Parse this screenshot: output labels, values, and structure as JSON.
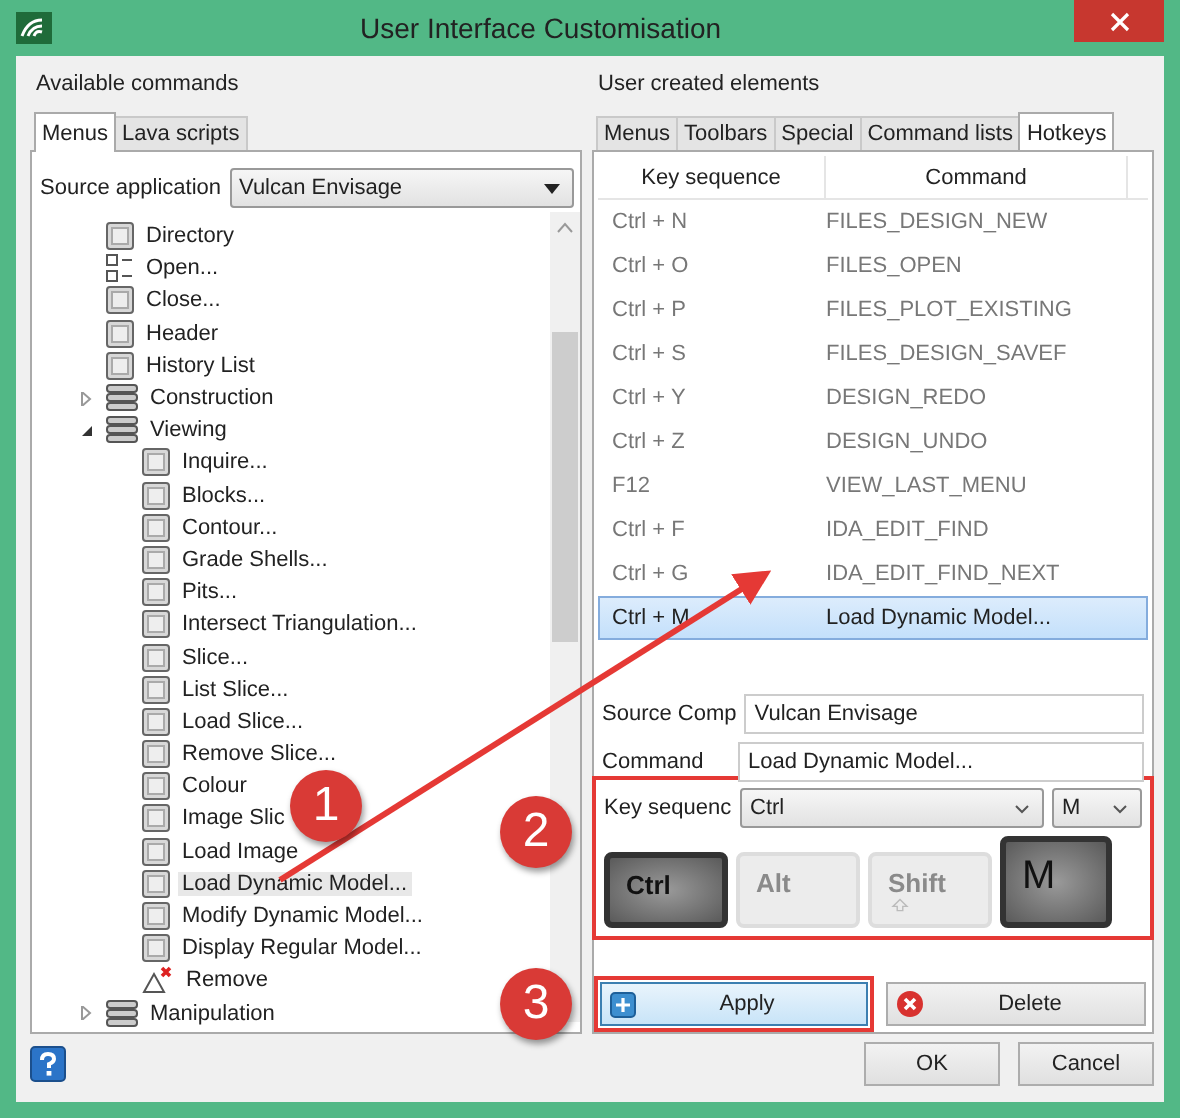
{
  "window": {
    "title": "User Interface Customisation"
  },
  "left": {
    "heading": "Available commands",
    "tabs": [
      {
        "label": "Menus",
        "selected": true
      },
      {
        "label": "Lava scripts",
        "selected": false
      }
    ],
    "source_label": "Source application",
    "source_value": "Vulcan Envisage",
    "tree": [
      {
        "label": "Directory",
        "kind": "command",
        "selected": false
      },
      {
        "label": "Open...",
        "kind": "list",
        "selected": false
      },
      {
        "label": "Close...",
        "kind": "command",
        "selected": false
      },
      {
        "label": "Header",
        "kind": "command",
        "selected": false
      },
      {
        "label": "History List",
        "kind": "command",
        "selected": false
      },
      {
        "label": "Construction",
        "kind": "group",
        "expanded": false,
        "selected": false
      },
      {
        "label": "Viewing",
        "kind": "group",
        "expanded": true,
        "selected": false,
        "children": [
          {
            "label": "Inquire...",
            "kind": "command",
            "selected": false
          },
          {
            "label": "Blocks...",
            "kind": "command",
            "selected": false
          },
          {
            "label": "Contour...",
            "kind": "command",
            "selected": false
          },
          {
            "label": "Grade Shells...",
            "kind": "command",
            "selected": false
          },
          {
            "label": "Pits...",
            "kind": "command",
            "selected": false
          },
          {
            "label": "Intersect Triangulation...",
            "kind": "command",
            "selected": false
          },
          {
            "label": "Slice...",
            "kind": "command",
            "selected": false
          },
          {
            "label": "List Slice...",
            "kind": "command",
            "selected": false
          },
          {
            "label": "Load Slice...",
            "kind": "command",
            "selected": false
          },
          {
            "label": "Remove Slice...",
            "kind": "command",
            "selected": false
          },
          {
            "label": "Colour",
            "kind": "command",
            "selected": false
          },
          {
            "label": "Image Slic",
            "kind": "command",
            "selected": false
          },
          {
            "label": "Load Image",
            "kind": "command",
            "selected": false
          },
          {
            "label": "Load Dynamic Model...",
            "kind": "command",
            "selected": true
          },
          {
            "label": "Modify Dynamic Model...",
            "kind": "command",
            "selected": false
          },
          {
            "label": "Display Regular Model...",
            "kind": "command",
            "selected": false
          },
          {
            "label": "Remove",
            "kind": "remove",
            "selected": false
          }
        ]
      },
      {
        "label": "Manipulation",
        "kind": "group",
        "expanded": false,
        "selected": false
      }
    ]
  },
  "right": {
    "heading": "User created elements",
    "tabs": [
      {
        "label": "Menus",
        "selected": false
      },
      {
        "label": "Toolbars",
        "selected": false
      },
      {
        "label": "Special",
        "selected": false
      },
      {
        "label": "Command lists",
        "selected": false
      },
      {
        "label": "Hotkeys",
        "selected": true
      }
    ],
    "table": {
      "columns": [
        "Key sequence",
        "Command"
      ],
      "rows": [
        {
          "keys": "Ctrl + N",
          "command": "FILES_DESIGN_NEW",
          "selected": false
        },
        {
          "keys": "Ctrl + O",
          "command": "FILES_OPEN",
          "selected": false
        },
        {
          "keys": "Ctrl + P",
          "command": "FILES_PLOT_EXISTING",
          "selected": false
        },
        {
          "keys": "Ctrl + S",
          "command": "FILES_DESIGN_SAVEF",
          "selected": false
        },
        {
          "keys": "Ctrl + Y",
          "command": "DESIGN_REDO",
          "selected": false
        },
        {
          "keys": "Ctrl + Z",
          "command": "DESIGN_UNDO",
          "selected": false
        },
        {
          "keys": "F12",
          "command": "VIEW_LAST_MENU",
          "selected": false
        },
        {
          "keys": "Ctrl + F",
          "command": "IDA_EDIT_FIND",
          "selected": false
        },
        {
          "keys": "Ctrl + G",
          "command": "IDA_EDIT_FIND_NEXT",
          "selected": false
        },
        {
          "keys": "Ctrl + M",
          "command": "Load Dynamic Model...",
          "selected": true
        }
      ]
    },
    "fields": [
      {
        "label": "Source Comp",
        "value": "Vulcan Envisage"
      },
      {
        "label": "Command",
        "value": "Load Dynamic Model..."
      }
    ],
    "key_sequence": {
      "label": "Key sequenc",
      "modifier": "Ctrl",
      "key": "M",
      "keycaps": [
        {
          "label": "Ctrl",
          "pressed": true,
          "kind": "small"
        },
        {
          "label": "Alt",
          "pressed": false,
          "kind": "small"
        },
        {
          "label": "Shift",
          "pressed": false,
          "kind": "shift"
        },
        {
          "label": "M",
          "pressed": true,
          "kind": "large"
        }
      ]
    },
    "apply": "Apply",
    "delete": "Delete"
  },
  "buttons": [
    "OK",
    "Cancel"
  ],
  "callouts": [
    "1",
    "2",
    "3"
  ]
}
